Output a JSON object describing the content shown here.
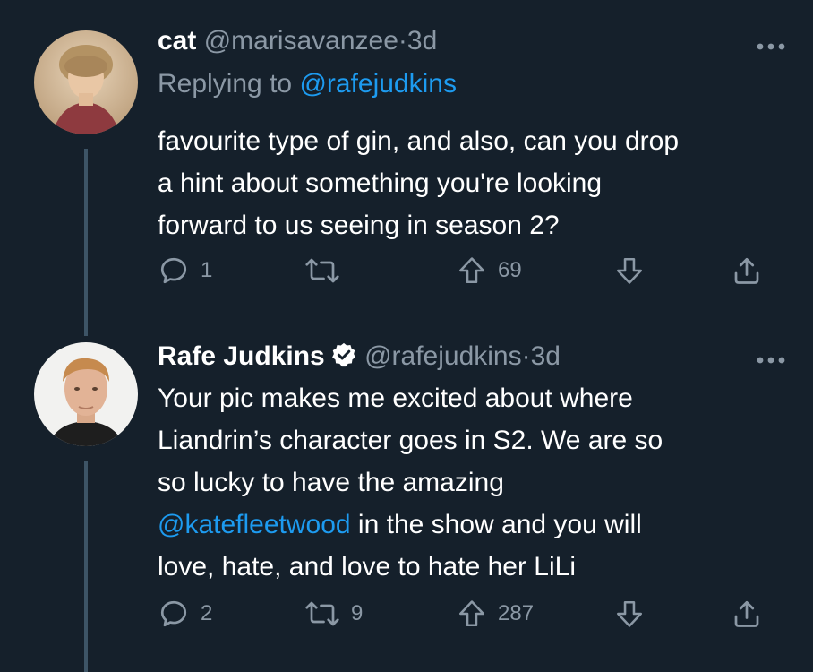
{
  "tweets": [
    {
      "display_name": "cat",
      "handle": "@marisavanzee",
      "separator": "·",
      "time": "3d",
      "reply_prefix": "Replying to ",
      "reply_to": "@rafejudkins",
      "lines": [
        "favourite type of gin, and also, can you drop",
        "a hint about something you're looking",
        "forward to us seeing in season 2?"
      ],
      "counts": {
        "replies": "1",
        "retweets": "",
        "upvotes": "69"
      },
      "verified": false
    },
    {
      "display_name": "Rafe Judkins",
      "handle": "@rafejudkins",
      "separator": "·",
      "time": "3d",
      "text_line1": "Your pic makes me excited about where",
      "text_line2": "Liandrin’s character goes in S2.  We are so",
      "text_line3": "so lucky to have the amazing",
      "mention": "@katefleetwood",
      "text_line4_rest": " in the show and you will",
      "text_line5": "love, hate, and love to hate her LiLi",
      "counts": {
        "replies": "2",
        "retweets": "9",
        "upvotes": "287"
      },
      "verified": true
    }
  ],
  "colors": {
    "background": "#15202b",
    "text": "#ffffff",
    "muted": "#8b98a5",
    "link": "#1d9bf0",
    "thread_line": "#3d5466"
  },
  "icons": [
    "reply-icon",
    "retweet-icon",
    "upvote-icon",
    "downvote-icon",
    "share-icon",
    "more-icon",
    "verified-icon"
  ]
}
